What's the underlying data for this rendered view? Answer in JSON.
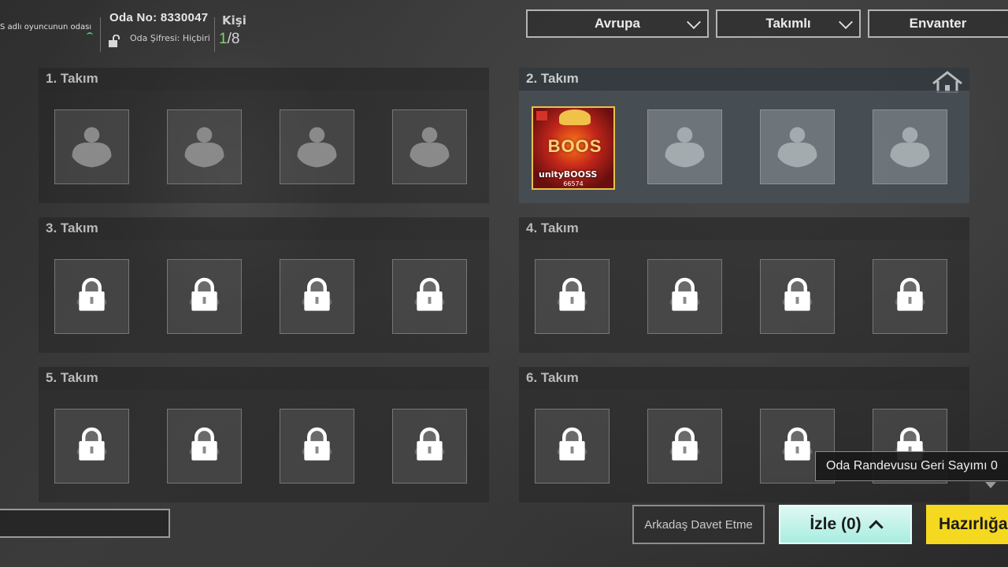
{
  "header": {
    "host_text": "S adlı oyuncunun odası",
    "room_no": "Oda No: 8330047",
    "room_password": "Oda Şifresi: Hiçbiri",
    "people_label": "Kişi",
    "people_current": "1",
    "people_total": "/8"
  },
  "dropdowns": {
    "region": "Avrupa",
    "mode": "Takımlı",
    "inventory": "Envanter"
  },
  "teams": [
    {
      "label": "1. Takım",
      "state": "open"
    },
    {
      "label": "2. Takım",
      "state": "active"
    },
    {
      "label": "3. Takım",
      "state": "locked"
    },
    {
      "label": "4. Takım",
      "state": "locked"
    },
    {
      "label": "5. Takım",
      "state": "locked"
    },
    {
      "label": "6. Takım",
      "state": "locked"
    }
  ],
  "player": {
    "card_text": "BOOS",
    "name": "unityBOOSS",
    "id": "66574"
  },
  "buttons": {
    "invite": "Arkadaş Davet Etme",
    "watch": "İzle (0)",
    "ready": "Hazırlığa"
  },
  "tooltip": {
    "text": "Oda Randevusu Geri Sayımı 0"
  },
  "colors": {
    "watch_button": "#c4f3ea",
    "ready_button": "#f5d820",
    "player_count_accent": "#7fd36b"
  },
  "icons": {
    "empty_slot": "person-silhouette-icon",
    "locked_slot": "padlock-icon",
    "home": "home-icon",
    "password": "unlocked-lock-icon",
    "dropdown": "chevron-down-icon"
  }
}
